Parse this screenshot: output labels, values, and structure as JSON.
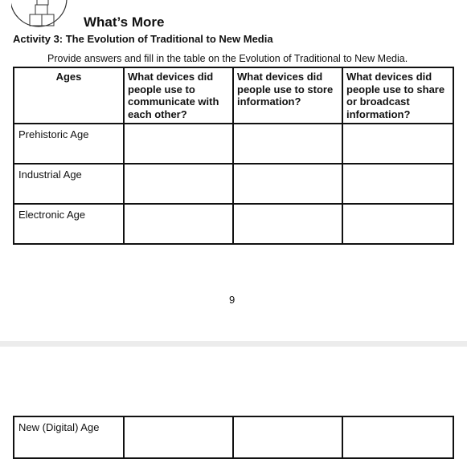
{
  "header": {
    "icon": "stacked-boxes-icon",
    "section_title": "What’s More",
    "activity_title": "Activity 3: The Evolution of Traditional to New Media",
    "instructions": "Provide answers and fill in the table on the Evolution of Traditional to New Media."
  },
  "table": {
    "columns": [
      "Ages",
      "What devices did people use to communicate with each other?",
      "What devices did people use to store information?",
      "What devices did people use to share or broadcast information?"
    ],
    "rows": [
      {
        "age": "Prehistoric Age",
        "communicate": "",
        "store": "",
        "share": ""
      },
      {
        "age": "Industrial Age",
        "communicate": "",
        "store": "",
        "share": ""
      },
      {
        "age": "Electronic Age",
        "communicate": "",
        "store": "",
        "share": ""
      }
    ],
    "continued_rows": [
      {
        "age": "New (Digital) Age",
        "communicate": "",
        "store": "",
        "share": ""
      }
    ]
  },
  "footer": {
    "page_number": "9"
  }
}
